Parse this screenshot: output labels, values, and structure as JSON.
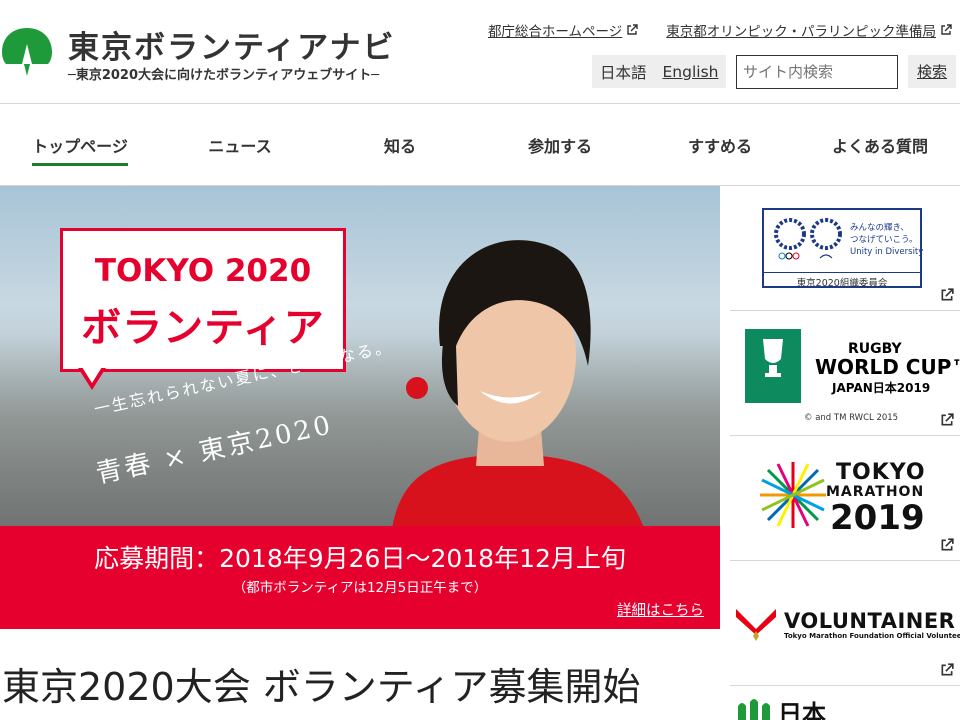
{
  "site": {
    "title": "東京ボランティアナビ",
    "subtitle": "─東京2020大会に向けたボランティアウェブサイト─"
  },
  "header": {
    "external_links": [
      "都庁総合ホームページ",
      "東京都オリンピック・パラリンピック準備局"
    ],
    "language": {
      "ja": "日本語",
      "en": "English"
    },
    "search": {
      "placeholder": "サイト内検索",
      "button": "検索"
    }
  },
  "nav": {
    "items": [
      "トップページ",
      "ニュース",
      "知る",
      "参加する",
      "すすめる",
      "よくある質問"
    ],
    "active_index": 0
  },
  "hero": {
    "bubble_line1": "TOKYO 2020",
    "bubble_line2": "ボランティア",
    "handwriting_1": "一生忘れられない夏に、きっとなる。",
    "handwriting_2": "青春 × 東京2020",
    "banner_period": "応募期間：2018年9月26日〜2018年12月上旬",
    "banner_note": "（都市ボランティアは12月5日正午まで）",
    "banner_more": "詳細はこちら"
  },
  "headline": "東京2020大会  ボランティア募集開始",
  "sidebar": {
    "tokyo2020": {
      "text1": "みんなの輝き、",
      "text2": "つなげていこう。",
      "text3": "Unity in Diversity",
      "caption": "東京2020組織委員会"
    },
    "rugby": {
      "line1": "RUGBY",
      "line2": "WORLD CUP™",
      "line3": "JAPAN日本2019",
      "copyright": "© and TM RWCL 2015"
    },
    "marathon": {
      "line1": "TOKYO",
      "line2": "MARATHON",
      "line3": "2019"
    },
    "voluntainer": {
      "line1": "VOLUNTAINER",
      "line2": "Tokyo Marathon Foundation Official Volunteer Club"
    },
    "nihon": {
      "line1": "日本"
    }
  },
  "colors": {
    "accent_red": "#e6002d",
    "nav_active": "#1e7a2c",
    "logo_green": "#1e9a3a"
  }
}
